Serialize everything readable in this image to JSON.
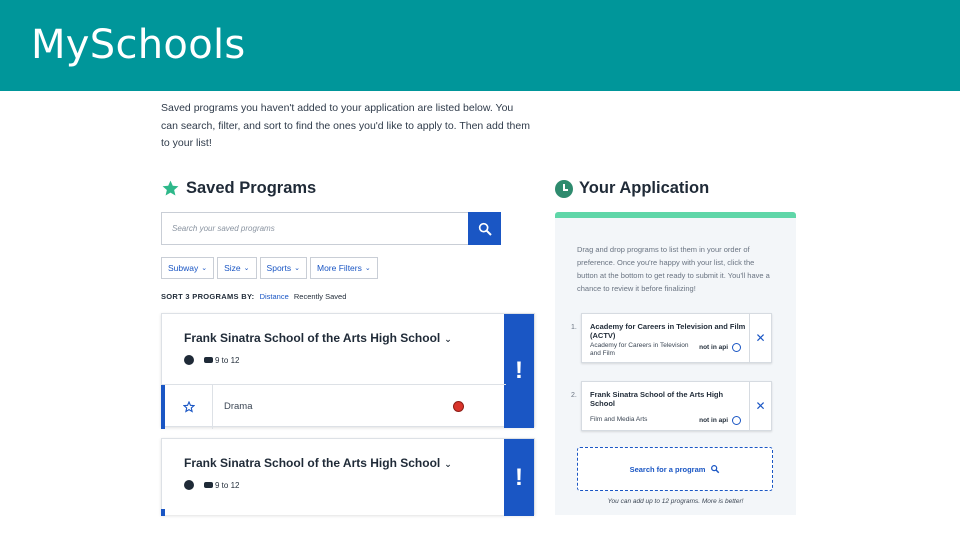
{
  "header": {
    "title": "MySchools"
  },
  "intro_text": "Saved programs you haven't added to your application are listed below. You can search, filter, and sort to find the ones you'd like to apply to. Then add them to your list!",
  "saved": {
    "title": "Saved Programs",
    "search_placeholder": "Search your saved programs",
    "filters": [
      "Subway",
      "Size",
      "Sports",
      "More Filters"
    ],
    "sort_label": "SORT 3 PROGRAMS BY:",
    "sort_options": [
      "Distance",
      "Recently Saved"
    ],
    "cards": [
      {
        "name": "Frank Sinatra School of the Arts High School",
        "grades": "9 to 12",
        "program": "Drama",
        "alert": "!"
      },
      {
        "name": "Frank Sinatra School of the Arts High School",
        "grades": "9 to 12",
        "alert": "!"
      }
    ]
  },
  "application": {
    "title": "Your Application",
    "intro": "Drag and drop programs to list them in your order of preference. Once you're happy with your list, click the button at the bottom to get ready to submit it. You'll have a chance to review it before finalizing!",
    "items": [
      {
        "num": "1.",
        "name": "Academy for Careers in Television and Film (ACTV)",
        "sub": "Academy for Careers in Television and Film",
        "status": "not in api"
      },
      {
        "num": "2.",
        "name": "Frank Sinatra School of the Arts High School",
        "sub": "Film and Media Arts",
        "status": "not in api"
      }
    ],
    "search_label": "Search for a program",
    "footer": "You can add up to 12 programs. More is better!"
  },
  "colors": {
    "banner": "#00969a",
    "accent_blue": "#1a56c4",
    "accent_green": "#5fd6a8",
    "star": "#2eb88a"
  },
  "icons": [
    "star-icon",
    "clock-icon",
    "search-icon",
    "chevron-down-icon",
    "accessibility-icon",
    "bus-icon",
    "info-icon",
    "close-icon",
    "alert-icon"
  ]
}
